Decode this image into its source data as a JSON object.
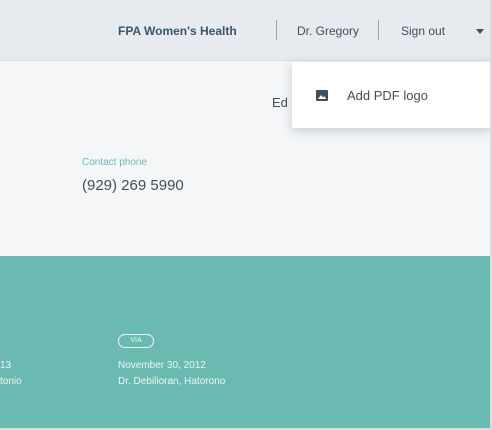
{
  "header": {
    "organization": "FPA Women's Health",
    "user": "Dr. Gregory",
    "signout_label": "Sign out",
    "signout_icon": "caret-down-icon"
  },
  "dropdown": {
    "items": [
      {
        "label": "Add PDF logo",
        "icon": "image-icon"
      }
    ]
  },
  "content": {
    "edit_partial": "Ed",
    "contact_phone_label": "Contact phone",
    "contact_phone_value": "(929) 269 5990"
  },
  "panel": {
    "left_line1": "13",
    "left_line2": "tonio",
    "badge": "VIA",
    "date": "November 30, 2012",
    "doctor": "Dr. Debilioran, Hatorono"
  },
  "colors": {
    "accent": "#6bbab2",
    "text": "#3e4f5e",
    "topbar": "#e7ebef",
    "content_bg": "#f4f6f8"
  }
}
